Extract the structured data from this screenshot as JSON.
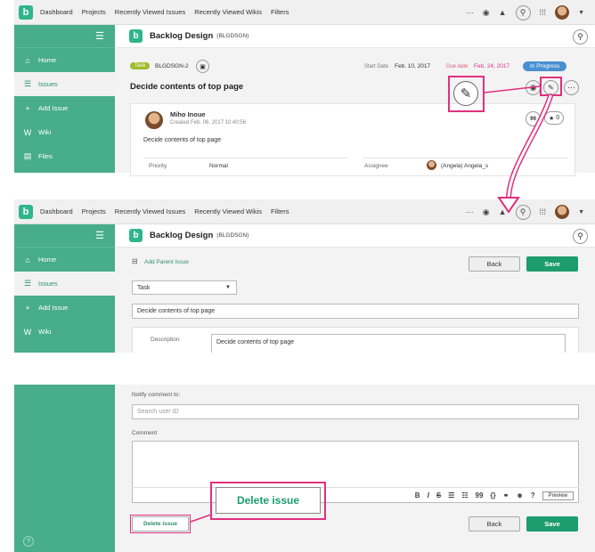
{
  "topnav": {
    "logo_letter": "b",
    "links": [
      "Dashboard",
      "Projects",
      "Recently Viewed Issues",
      "Recently Viewed Wikis",
      "Filters"
    ],
    "more_glyph": "···"
  },
  "sidebar": {
    "menu_glyph": "☰",
    "items": [
      "Home",
      "Issues",
      "Add Issue",
      "Wiki",
      "Files"
    ],
    "help_glyph": "?"
  },
  "project": {
    "logo_letter": "b",
    "name": "Backlog Design",
    "key": "(BLGDSGN)"
  },
  "issue_view": {
    "type_tag": "Task",
    "issue_key": "BLGDSGN-2",
    "start_label": "Start Date",
    "start_date": "Feb. 10, 2017",
    "due_label": "Due date",
    "due_date": "Feb. 24, 2017",
    "status": "In Progress",
    "title": "Decide contents of top page",
    "author": "Miho Inoue",
    "created": "Created Feb. 06, 2017 10:40:56",
    "description": "Decide contents of top page",
    "star_count": "0",
    "quote_glyph": "99",
    "priority_label": "Priority",
    "priority_value": "Normal",
    "assignee_label": "Assignee",
    "assignee_value": "(Angela) Angela_s"
  },
  "edit_form": {
    "add_parent": "Add Parent Issue",
    "back": "Back",
    "save": "Save",
    "issue_type": "Task",
    "subject": "Decide contents of top page",
    "description_label": "Description",
    "description_value": "Decide contents of top page"
  },
  "bottom_form": {
    "notify_label": "Notify comment to:",
    "user_placeholder": "Search user ID",
    "comment_label": "Comment",
    "toolbar": [
      "B",
      "I",
      "S",
      "☰",
      "☷",
      "99",
      "{}",
      "⚭",
      "☻",
      "?"
    ],
    "preview": "Preview",
    "delete": "Delete issue",
    "delete_callout": "Delete issue",
    "back": "Back",
    "save": "Save"
  },
  "colors": {
    "brand_green": "#47ad8b",
    "save_green": "#1d9c6e",
    "highlight_pink": "#e0307e",
    "status_blue": "#4a8fd0"
  }
}
